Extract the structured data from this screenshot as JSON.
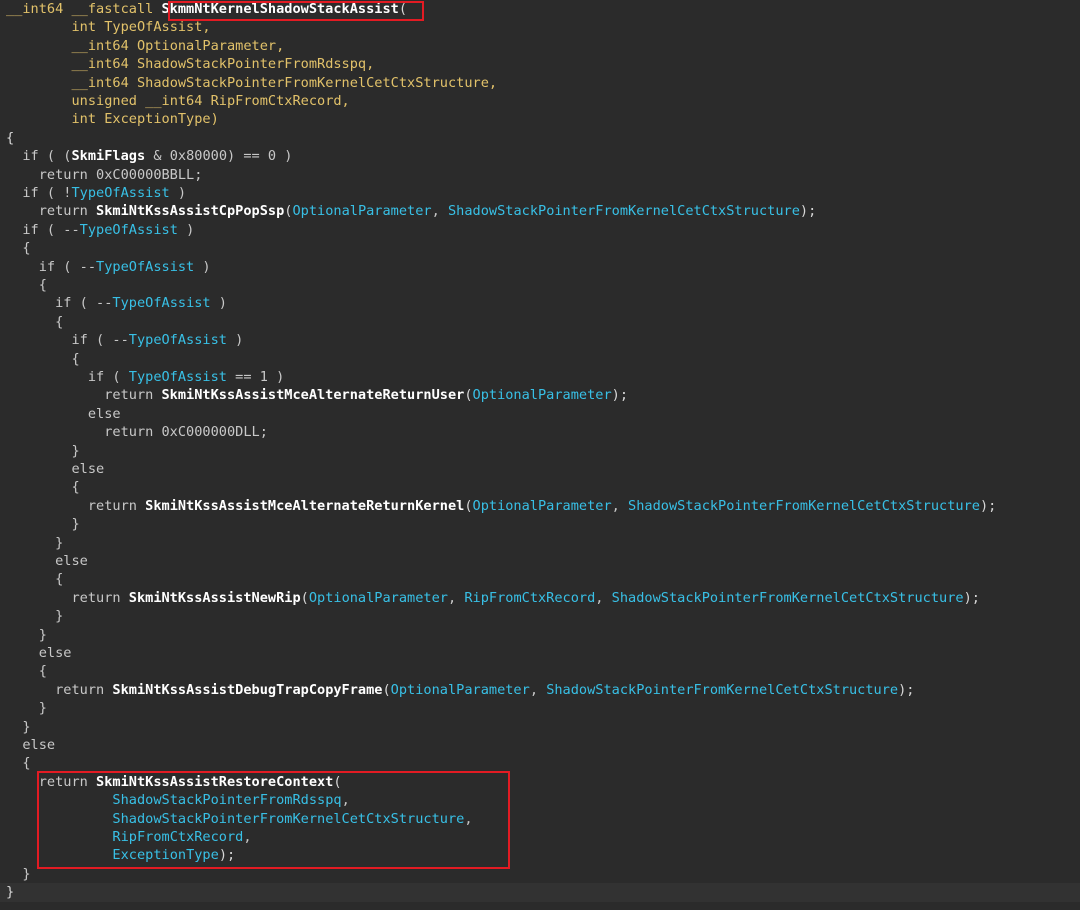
{
  "palette": {
    "keyword": "#cc7832",
    "type": "#e2c26a",
    "function": "#ffffff",
    "variable": "#38c0e6",
    "plain": "#c8c8c8",
    "highlight_border": "#e31b23"
  },
  "lines": [
    [
      [
        "ty",
        "__int64 __fastcall "
      ],
      [
        "fn",
        "SkmmNtKernelShadowStackAssist"
      ],
      [
        "pn",
        "("
      ]
    ],
    [
      [
        "pl",
        "        "
      ],
      [
        "ty",
        "int TypeOfAssist,"
      ]
    ],
    [
      [
        "pl",
        "        "
      ],
      [
        "ty",
        "__int64 OptionalParameter,"
      ]
    ],
    [
      [
        "pl",
        "        "
      ],
      [
        "ty",
        "__int64 ShadowStackPointerFromRdsspq,"
      ]
    ],
    [
      [
        "pl",
        "        "
      ],
      [
        "ty",
        "__int64 ShadowStackPointerFromKernelCetCtxStructure,"
      ]
    ],
    [
      [
        "pl",
        "        "
      ],
      [
        "ty",
        "unsigned __int64 RipFromCtxRecord,"
      ]
    ],
    [
      [
        "pl",
        "        "
      ],
      [
        "ty",
        "int ExceptionType)"
      ]
    ],
    [
      [
        "pn",
        "{"
      ]
    ],
    [
      [
        "pl",
        "  "
      ],
      [
        "pl",
        "if ( ("
      ],
      [
        "fn",
        "SkmiFlags"
      ],
      [
        "pl",
        " & 0x80000) == 0 )"
      ]
    ],
    [
      [
        "pl",
        "    return 0xC00000BBLL;"
      ]
    ],
    [
      [
        "pl",
        "  if ( !"
      ],
      [
        "vr",
        "TypeOfAssist"
      ],
      [
        "pl",
        " )"
      ]
    ],
    [
      [
        "pl",
        "    return "
      ],
      [
        "fn",
        "SkmiNtKssAssistCpPopSsp"
      ],
      [
        "pn",
        "("
      ],
      [
        "vr",
        "OptionalParameter"
      ],
      [
        "pl",
        ", "
      ],
      [
        "vr",
        "ShadowStackPointerFromKernelCetCtxStructure"
      ],
      [
        "pn",
        ");"
      ]
    ],
    [
      [
        "pl",
        "  if ( --"
      ],
      [
        "vr",
        "TypeOfAssist"
      ],
      [
        "pl",
        " )"
      ]
    ],
    [
      [
        "pl",
        "  {"
      ]
    ],
    [
      [
        "pl",
        "    if ( --"
      ],
      [
        "vr",
        "TypeOfAssist"
      ],
      [
        "pl",
        " )"
      ]
    ],
    [
      [
        "pl",
        "    {"
      ]
    ],
    [
      [
        "pl",
        "      if ( --"
      ],
      [
        "vr",
        "TypeOfAssist"
      ],
      [
        "pl",
        " )"
      ]
    ],
    [
      [
        "pl",
        "      {"
      ]
    ],
    [
      [
        "pl",
        "        if ( --"
      ],
      [
        "vr",
        "TypeOfAssist"
      ],
      [
        "pl",
        " )"
      ]
    ],
    [
      [
        "pl",
        "        {"
      ]
    ],
    [
      [
        "pl",
        "          if ( "
      ],
      [
        "vr",
        "TypeOfAssist"
      ],
      [
        "pl",
        " == 1 )"
      ]
    ],
    [
      [
        "pl",
        "            return "
      ],
      [
        "fn",
        "SkmiNtKssAssistMceAlternateReturnUser"
      ],
      [
        "pn",
        "("
      ],
      [
        "vr",
        "OptionalParameter"
      ],
      [
        "pn",
        ");"
      ]
    ],
    [
      [
        "pl",
        "          else"
      ]
    ],
    [
      [
        "pl",
        "            return 0xC000000DLL;"
      ]
    ],
    [
      [
        "pl",
        "        }"
      ]
    ],
    [
      [
        "pl",
        "        else"
      ]
    ],
    [
      [
        "pl",
        "        {"
      ]
    ],
    [
      [
        "pl",
        "          return "
      ],
      [
        "fn",
        "SkmiNtKssAssistMceAlternateReturnKernel"
      ],
      [
        "pn",
        "("
      ],
      [
        "vr",
        "OptionalParameter"
      ],
      [
        "pl",
        ", "
      ],
      [
        "vr",
        "ShadowStackPointerFromKernelCetCtxStructure"
      ],
      [
        "pn",
        ");"
      ]
    ],
    [
      [
        "pl",
        "        }"
      ]
    ],
    [
      [
        "pl",
        "      }"
      ]
    ],
    [
      [
        "pl",
        "      else"
      ]
    ],
    [
      [
        "pl",
        "      {"
      ]
    ],
    [
      [
        "pl",
        "        return "
      ],
      [
        "fn",
        "SkmiNtKssAssistNewRip"
      ],
      [
        "pn",
        "("
      ],
      [
        "vr",
        "OptionalParameter"
      ],
      [
        "pl",
        ", "
      ],
      [
        "vr",
        "RipFromCtxRecord"
      ],
      [
        "pl",
        ", "
      ],
      [
        "vr",
        "ShadowStackPointerFromKernelCetCtxStructure"
      ],
      [
        "pn",
        ");"
      ]
    ],
    [
      [
        "pl",
        "      }"
      ]
    ],
    [
      [
        "pl",
        "    }"
      ]
    ],
    [
      [
        "pl",
        "    else"
      ]
    ],
    [
      [
        "pl",
        "    {"
      ]
    ],
    [
      [
        "pl",
        "      return "
      ],
      [
        "fn",
        "SkmiNtKssAssistDebugTrapCopyFrame"
      ],
      [
        "pn",
        "("
      ],
      [
        "vr",
        "OptionalParameter"
      ],
      [
        "pl",
        ", "
      ],
      [
        "vr",
        "ShadowStackPointerFromKernelCetCtxStructure"
      ],
      [
        "pn",
        ");"
      ]
    ],
    [
      [
        "pl",
        "    }"
      ]
    ],
    [
      [
        "pl",
        "  }"
      ]
    ],
    [
      [
        "pl",
        "  else"
      ]
    ],
    [
      [
        "pl",
        "  {"
      ]
    ],
    [
      [
        "pl",
        "    return "
      ],
      [
        "fn",
        "SkmiNtKssAssistRestoreContext"
      ],
      [
        "pn",
        "("
      ]
    ],
    [
      [
        "pl",
        "             "
      ],
      [
        "vr",
        "ShadowStackPointerFromRdsspq"
      ],
      [
        "pl",
        ","
      ]
    ],
    [
      [
        "pl",
        "             "
      ],
      [
        "vr",
        "ShadowStackPointerFromKernelCetCtxStructure"
      ],
      [
        "pl",
        ","
      ]
    ],
    [
      [
        "pl",
        "             "
      ],
      [
        "vr",
        "RipFromCtxRecord"
      ],
      [
        "pl",
        ","
      ]
    ],
    [
      [
        "pl",
        "             "
      ],
      [
        "vr",
        "ExceptionType"
      ],
      [
        "pn",
        ");"
      ]
    ],
    [
      [
        "pl",
        "  }"
      ]
    ],
    [
      [
        "pn",
        "}"
      ]
    ]
  ]
}
